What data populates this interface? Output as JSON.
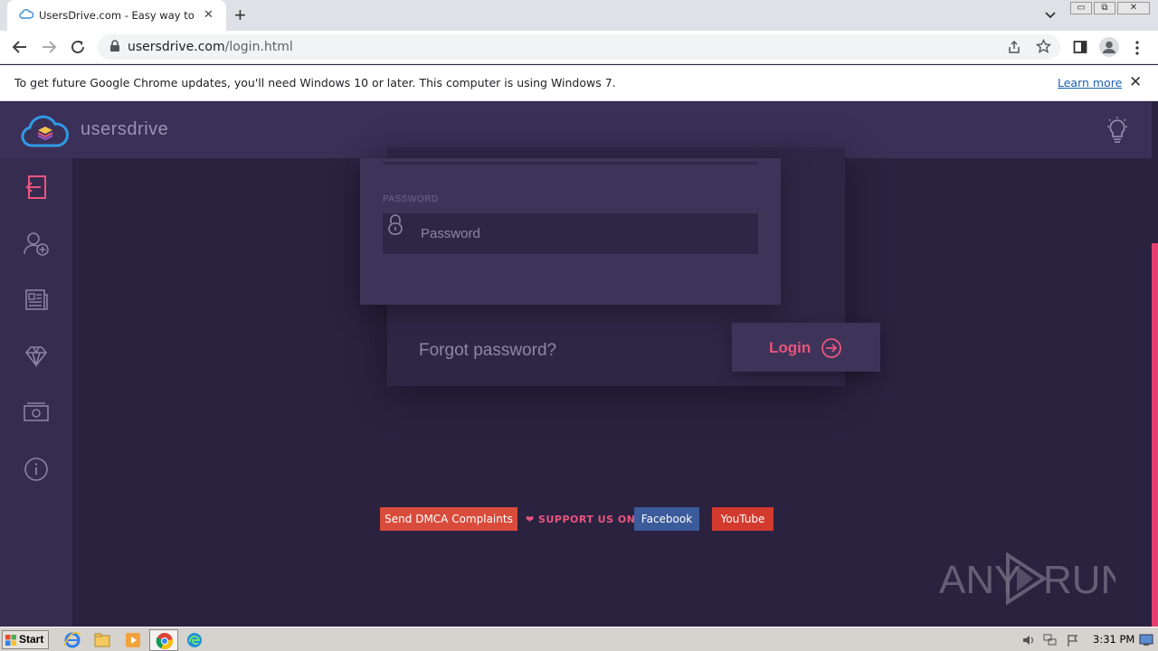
{
  "browser": {
    "tab_title": "UsersDrive.com - Easy way to share",
    "tab_close": "✕",
    "new_tab": "+",
    "url_host": "usersdrive.com",
    "url_path": "/login.html",
    "window_buttons": [
      "▭",
      "⧉",
      "✕"
    ]
  },
  "infobar": {
    "message": "To get future Google Chrome updates, you'll need Windows 10 or later. This computer is using Windows 7.",
    "link": "Learn more",
    "close": "✕"
  },
  "site": {
    "brand": "usersdrive",
    "colors": {
      "accent": "#e9557e",
      "background": "#2b2240",
      "header": "#3b3057",
      "sidebar": "#362c4f",
      "card": "#3e3459"
    },
    "sidebar_icons": [
      "login-icon",
      "add-user-icon",
      "news-icon",
      "diamond-icon",
      "money-icon",
      "info-icon"
    ],
    "form": {
      "password_label": "PASSWORD",
      "password_placeholder": "Password",
      "forgot_label": "Forgot password?",
      "login_label": "Login"
    },
    "footer": {
      "dmca": "Send DMCA Complaints",
      "support": "❤ SUPPORT US ON",
      "facebook": "Facebook",
      "youtube": "YouTube"
    }
  },
  "taskbar": {
    "start_label": "Start",
    "clock": "3:31 PM"
  }
}
